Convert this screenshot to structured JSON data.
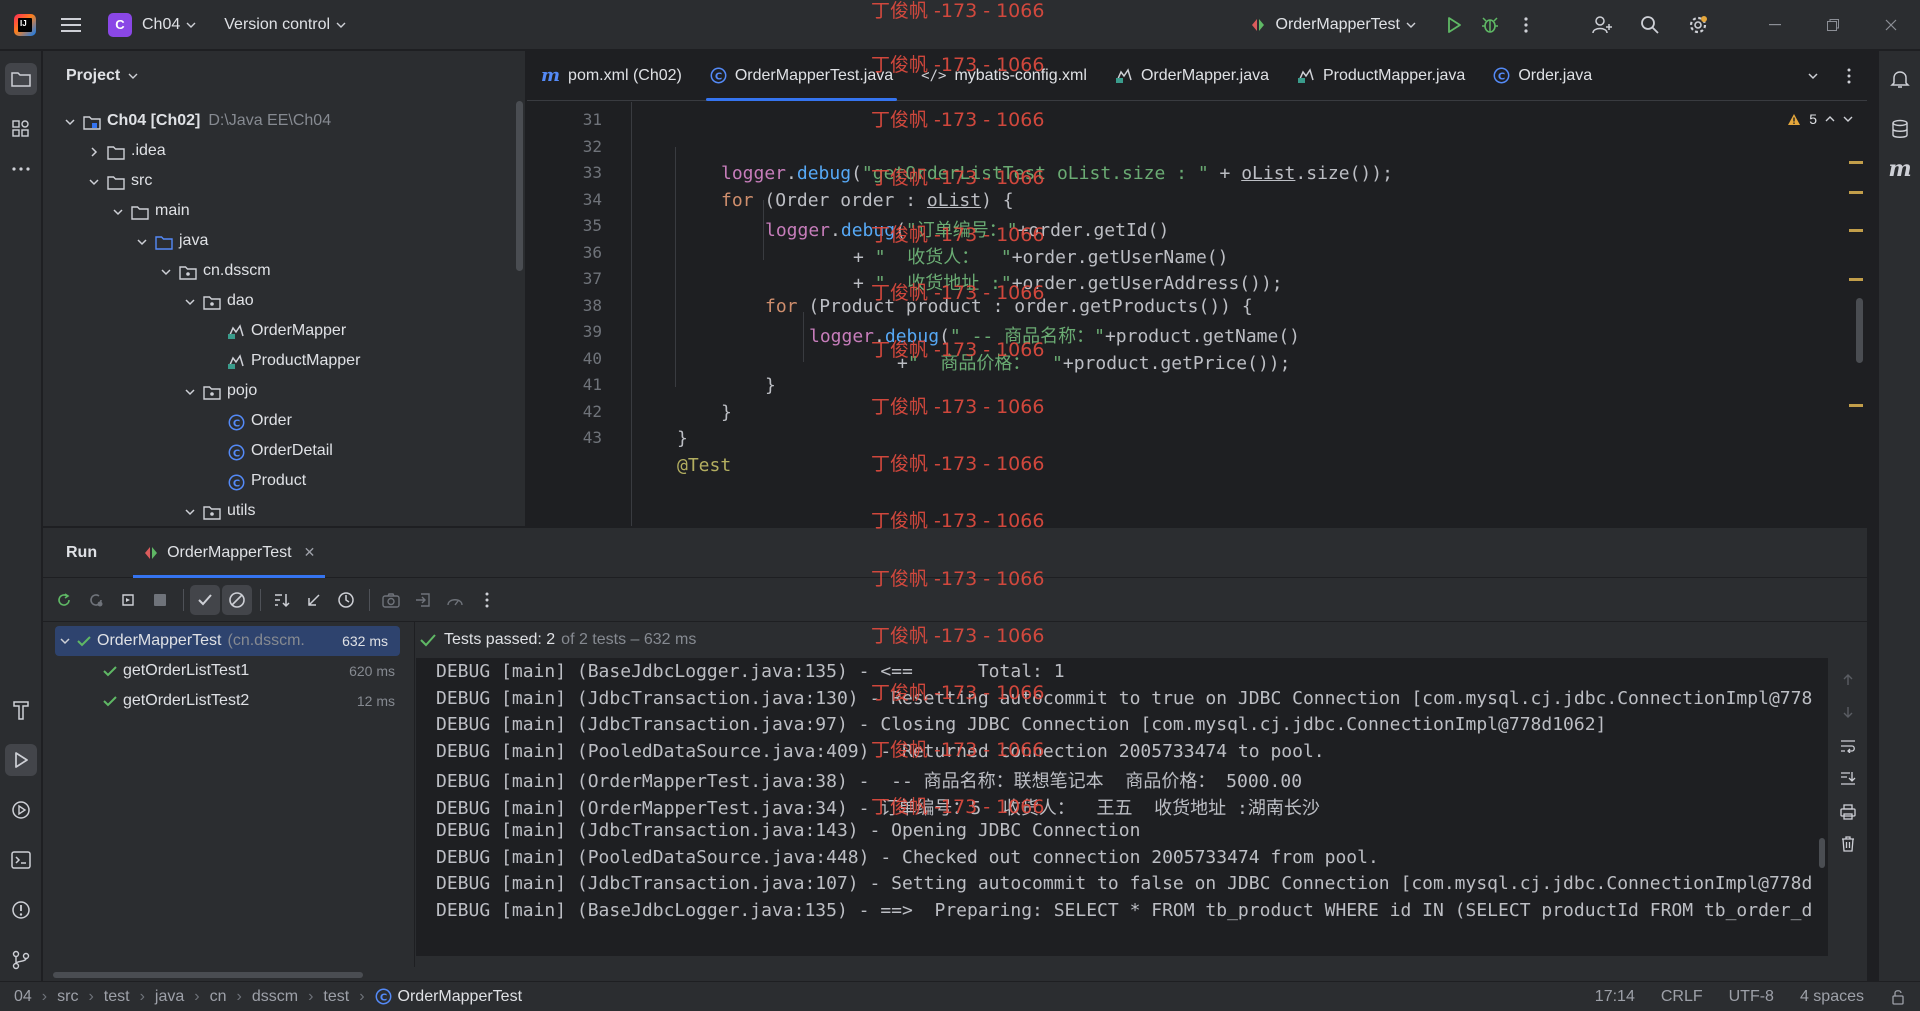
{
  "titlebar": {
    "app_logo_text": "IJ",
    "project_badge": "C",
    "project_name": "Ch04",
    "vcs_label": "Version control",
    "run_config": "OrderMapperTest"
  },
  "watermark": "丁俊帆 -173 - 1066",
  "project_panel": {
    "title": "Project",
    "tree": [
      {
        "label": "Ch04 [Ch02]",
        "hint": "D:\\Java EE\\Ch04",
        "icon": "module-folder-icon",
        "depth": 0,
        "arrow": "down",
        "bold": true
      },
      {
        "label": ".idea",
        "icon": "folder-icon",
        "depth": 1,
        "arrow": "right"
      },
      {
        "label": "src",
        "icon": "folder-icon",
        "depth": 1,
        "arrow": "down"
      },
      {
        "label": "main",
        "icon": "folder-icon",
        "depth": 2,
        "arrow": "down"
      },
      {
        "label": "java",
        "icon": "source-folder-icon",
        "depth": 3,
        "arrow": "down"
      },
      {
        "label": "cn.dsscm",
        "icon": "package-icon",
        "depth": 4,
        "arrow": "down"
      },
      {
        "label": "dao",
        "icon": "package-icon",
        "depth": 5,
        "arrow": "down"
      },
      {
        "label": "OrderMapper",
        "icon": "mybatis-mapper-icon",
        "depth": 6,
        "arrow": ""
      },
      {
        "label": "ProductMapper",
        "icon": "mybatis-mapper-icon",
        "depth": 6,
        "arrow": ""
      },
      {
        "label": "pojo",
        "icon": "package-icon",
        "depth": 5,
        "arrow": "down"
      },
      {
        "label": "Order",
        "icon": "class-icon",
        "depth": 6,
        "arrow": ""
      },
      {
        "label": "OrderDetail",
        "icon": "class-icon",
        "depth": 6,
        "arrow": ""
      },
      {
        "label": "Product",
        "icon": "class-icon",
        "depth": 6,
        "arrow": ""
      },
      {
        "label": "utils",
        "icon": "package-icon",
        "depth": 5,
        "arrow": "down"
      }
    ]
  },
  "editor": {
    "tabs": [
      {
        "label": "pom.xml (Ch02)",
        "icon": "maven-icon",
        "active": false
      },
      {
        "label": "OrderMapperTest.java",
        "icon": "class-icon",
        "active": true
      },
      {
        "label": "mybatis-config.xml",
        "icon": "xml-icon",
        "active": false
      },
      {
        "label": "OrderMapper.java",
        "icon": "mybatis-mapper-icon",
        "active": false
      },
      {
        "label": "ProductMapper.java",
        "icon": "mybatis-mapper-icon",
        "active": false
      },
      {
        "label": "Order.java",
        "icon": "class-icon",
        "active": false
      }
    ],
    "warnings_count": "5",
    "line_numbers": [
      "31",
      "32",
      "33",
      "34",
      "35",
      "36",
      "37",
      "38",
      "39",
      "40",
      "41",
      "42",
      "43"
    ]
  },
  "run_panel": {
    "title": "Run",
    "tab_label": "OrderMapperTest",
    "tests": [
      {
        "name": "OrderMapperTest",
        "detail": "(cn.dsscm.",
        "duration": "632 ms",
        "root": true
      },
      {
        "name": "getOrderListTest1",
        "detail": "",
        "duration": "620 ms",
        "root": false
      },
      {
        "name": "getOrderListTest2",
        "detail": "",
        "duration": "12 ms",
        "root": false
      }
    ],
    "summary": "Tests passed: 2",
    "summary_detail": "of 2 tests – 632 ms",
    "console": [
      "DEBUG [main] (BaseJdbcLogger.java:135) - <==      Total: 1",
      "DEBUG [main] (JdbcTransaction.java:130) - Resetting autocommit to true on JDBC Connection [com.mysql.cj.jdbc.ConnectionImpl@778",
      "DEBUG [main] (JdbcTransaction.java:97) - Closing JDBC Connection [com.mysql.cj.jdbc.ConnectionImpl@778d1062]",
      "DEBUG [main] (PooledDataSource.java:409) - Returned connection 2005733474 to pool.",
      "DEBUG [main] (OrderMapperTest.java:38) -  -- 商品名称：联想笔记本  商品价格： 5000.00",
      "DEBUG [main] (OrderMapperTest.java:34) - 订单编号：5  收货人：  王五  收货地址 :湖南长沙",
      "DEBUG [main] (JdbcTransaction.java:143) - Opening JDBC Connection",
      "DEBUG [main] (PooledDataSource.java:448) - Checked out connection 2005733474 from pool.",
      "DEBUG [main] (JdbcTransaction.java:107) - Setting autocommit to false on JDBC Connection [com.mysql.cj.jdbc.ConnectionImpl@778d",
      "DEBUG [main] (BaseJdbcLogger.java:135) - ==>  Preparing: SELECT * FROM tb_product WHERE id IN (SELECT productId FROM tb_order_d"
    ]
  },
  "statusbar": {
    "breadcrumbs": [
      "04",
      "src",
      "test",
      "java",
      "cn",
      "dsscm",
      "test",
      "OrderMapperTest"
    ],
    "position": "17:14",
    "line_sep": "CRLF",
    "encoding": "UTF-8",
    "indent": "4 spaces"
  },
  "code": {
    "l32_a": "logger",
    "l32_b": ".",
    "l32_c": "debug",
    "l32_d": "(",
    "l32_e": "\"getOrderListTest oList.size : \"",
    "l32_f": " + ",
    "l32_g": "oList",
    "l32_h": ".size());",
    "l33_a": "for",
    "l33_b": " (Order order : ",
    "l33_c": "oList",
    "l33_d": ") {",
    "l34_a": "logger",
    "l34_b": ".",
    "l34_c": "debug",
    "l34_d": "(",
    "l34_e": "\"订单编号：\"",
    "l34_f": "+order.getId()",
    "l35_a": "+ ",
    "l35_b": "\"  收货人：  \"",
    "l35_c": "+order.getUserName()",
    "l36_a": "+ ",
    "l36_b": "\"  收货地址 :\"",
    "l36_c": "+order.getUserAddress());",
    "l37_a": "for",
    "l37_b": " (Product product : order.getProducts()) {",
    "l38_a": "logger",
    "l38_b": ".",
    "l38_c": "debug",
    "l38_d": "(",
    "l38_e": "\" -- 商品名称：\"",
    "l38_f": "+product.getName()",
    "l39_a": "+",
    "l39_b": "\"  商品价格：  \"",
    "l39_c": "+product.getPrice());",
    "l40": "}",
    "l41": "}",
    "l42": "}",
    "l43": "@Test"
  }
}
